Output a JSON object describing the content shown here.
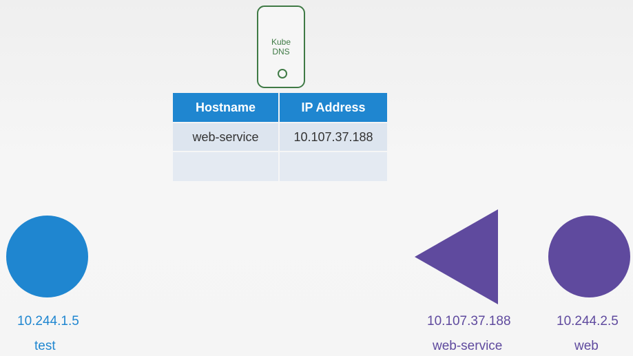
{
  "dns": {
    "title_line1": "Kube",
    "title_line2": "DNS"
  },
  "table": {
    "headers": [
      "Hostname",
      "IP Address"
    ],
    "rows": [
      [
        "web-service",
        "10.107.37.188"
      ],
      [
        "",
        ""
      ]
    ]
  },
  "nodes": {
    "test": {
      "ip": "10.244.1.5",
      "name": "test",
      "color": "#1f86d0"
    },
    "service": {
      "ip": "10.107.37.188",
      "name": "web-service",
      "color": "#5f4a9e"
    },
    "web": {
      "ip": "10.244.2.5",
      "name": "web",
      "color": "#5f4a9e"
    }
  },
  "colors": {
    "dns_green": "#3f7a45",
    "header_blue": "#1f86d0",
    "cell_bg": "#dde5ef"
  }
}
